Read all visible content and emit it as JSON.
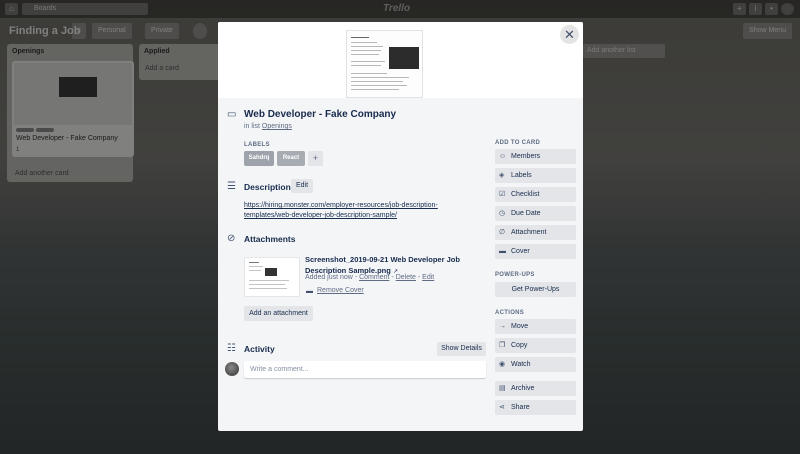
{
  "board": {
    "boards_label": "Boards",
    "logo": "Trello",
    "title": "Finding a Job",
    "visibility": [
      "Personal",
      "Private"
    ],
    "show_menu": "Show Menu",
    "lists": [
      {
        "title": "Openings",
        "card_title": "Web Developer - Fake Company",
        "card_badges": "1",
        "add_label": "Add another card"
      },
      {
        "title": "Applied",
        "add_label": "Add a card"
      }
    ],
    "add_list": "Add another list"
  },
  "modal": {
    "close_icon": "close-icon",
    "title": "Web Developer - Fake Company",
    "in_list_prefix": "in list",
    "in_list_name": "Openings",
    "labels_heading": "LABELS",
    "labels": [
      {
        "text": "Sahdrq",
        "color": "#9ea3ab"
      },
      {
        "text": "React",
        "color": "#a7abb2"
      }
    ],
    "label_add": "+",
    "description_heading": "Description",
    "description_edit": "Edit",
    "description_link": "https://hiring.monster.com/employer-resources/job-description-templates/web-developer-job-description-sample/",
    "attachments_heading": "Attachments",
    "attachment": {
      "name": "Screenshot_2019-09-21 Web Developer Job Description Sample.png",
      "arrow": "↗",
      "added": "Added just now",
      "comment": "Comment",
      "delete": "Delete",
      "edit": "Edit",
      "remove_cover": "Remove Cover"
    },
    "add_attachment": "Add an attachment",
    "activity_heading": "Activity",
    "show_details": "Show Details",
    "comment_placeholder": "Write a comment..."
  },
  "sidebar": {
    "add_to_card_heading": "ADD TO CARD",
    "add_to_card": [
      {
        "icon": "person-icon",
        "label": "Members"
      },
      {
        "icon": "tag-icon",
        "label": "Labels"
      },
      {
        "icon": "checklist-icon",
        "label": "Checklist"
      },
      {
        "icon": "clock-icon",
        "label": "Due Date"
      },
      {
        "icon": "paperclip-icon",
        "label": "Attachment"
      },
      {
        "icon": "cover-icon",
        "label": "Cover"
      }
    ],
    "powerups_heading": "POWER-UPS",
    "get_powerups": "Get Power-Ups",
    "actions_heading": "ACTIONS",
    "actions": [
      {
        "icon": "arrow-right-icon",
        "label": "Move"
      },
      {
        "icon": "copy-icon",
        "label": "Copy"
      },
      {
        "icon": "eye-icon",
        "label": "Watch"
      },
      {
        "icon": "archive-icon",
        "label": "Archive"
      },
      {
        "icon": "share-icon",
        "label": "Share"
      }
    ]
  }
}
